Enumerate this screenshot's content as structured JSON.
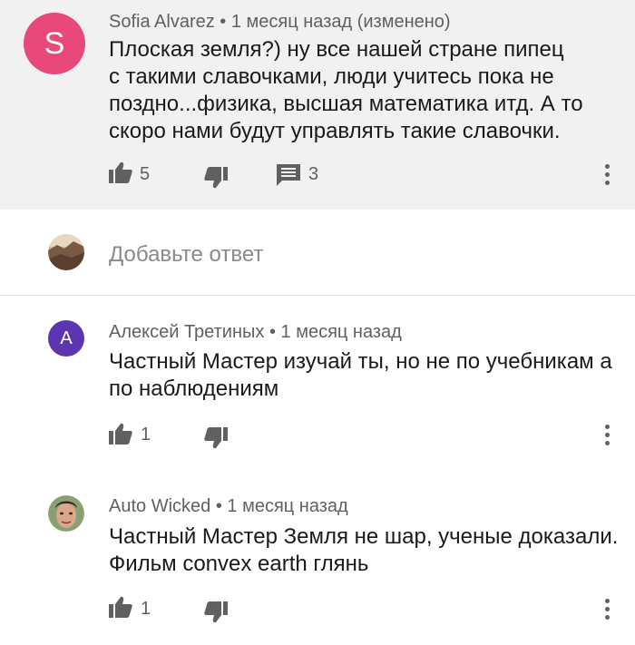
{
  "colors": {
    "avatar_sofia": "#e8487a",
    "avatar_aleksey": "#5e35b1",
    "top_comment_bg": "#f1f1f1",
    "icon_gray": "#606060"
  },
  "comments": [
    {
      "avatar_letter": "S",
      "author": "Sofia Alvarez",
      "time": "1 месяц назад (изменено)",
      "text_lines": [
        "Плоская земля?)  ну все нашей стране пипец",
        "с такими славочками,  люди учитесь пока не",
        "поздно...физика, высшая математика итд.  А то",
        "скоро нами будут управлять такие славочки."
      ],
      "likes": "5",
      "replies": "3"
    },
    {
      "avatar_letter": "А",
      "author": "Алексей Третиных",
      "time": "1 месяц назад",
      "text_lines": [
        "Частный Мастер изучай ты, но не по учебникам а",
        "по наблюдениям"
      ],
      "likes": "1"
    },
    {
      "avatar_icon": "user-photo-icon",
      "author": "Auto Wicked",
      "time": "1 месяц назад",
      "text_lines": [
        "Частный Мастер Земля не шар, ученые доказали.",
        "Фильм convex earth глянь"
      ],
      "likes": "1"
    }
  ],
  "reply_box": {
    "placeholder": "Добавьте ответ",
    "avatar_icon": "landscape-avatar-icon"
  },
  "separator": " • "
}
